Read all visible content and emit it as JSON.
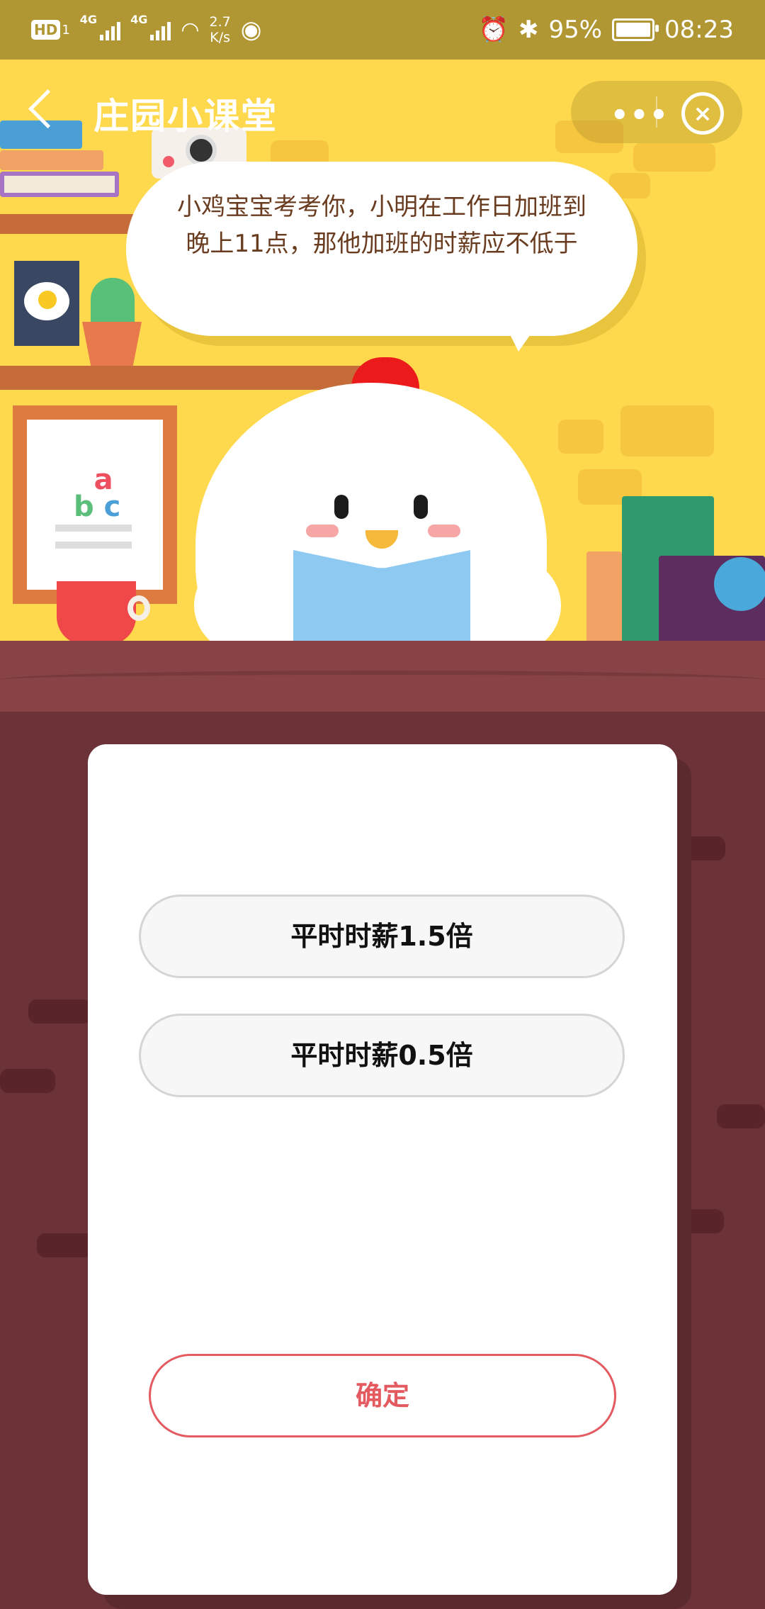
{
  "status_bar": {
    "hd_label": "HD",
    "sim_label": "1",
    "net1": "4G",
    "net2": "4G",
    "speed_value": "2.7",
    "speed_unit": "K/s",
    "battery": "95%",
    "time": "08:23"
  },
  "nav": {
    "title": "庄园小课堂",
    "more_icon": "more-dots",
    "close_icon": "close-circle"
  },
  "question": {
    "text": "小鸡宝宝考考你，小明在工作日加班到晚上11点，那他加班的时薪应不低于"
  },
  "scene": {
    "abc_a": "a",
    "abc_b": "b",
    "abc_c": "c"
  },
  "options": [
    {
      "label": "平时时薪1.5倍"
    },
    {
      "label": "平时时薪0.5倍"
    }
  ],
  "confirm_label": "确定",
  "colors": {
    "status_bar": "#b19733",
    "scene_bg": "#fed94e",
    "counter": "#884346",
    "page_bg": "#6b3238",
    "accent_red": "#e35a60"
  }
}
